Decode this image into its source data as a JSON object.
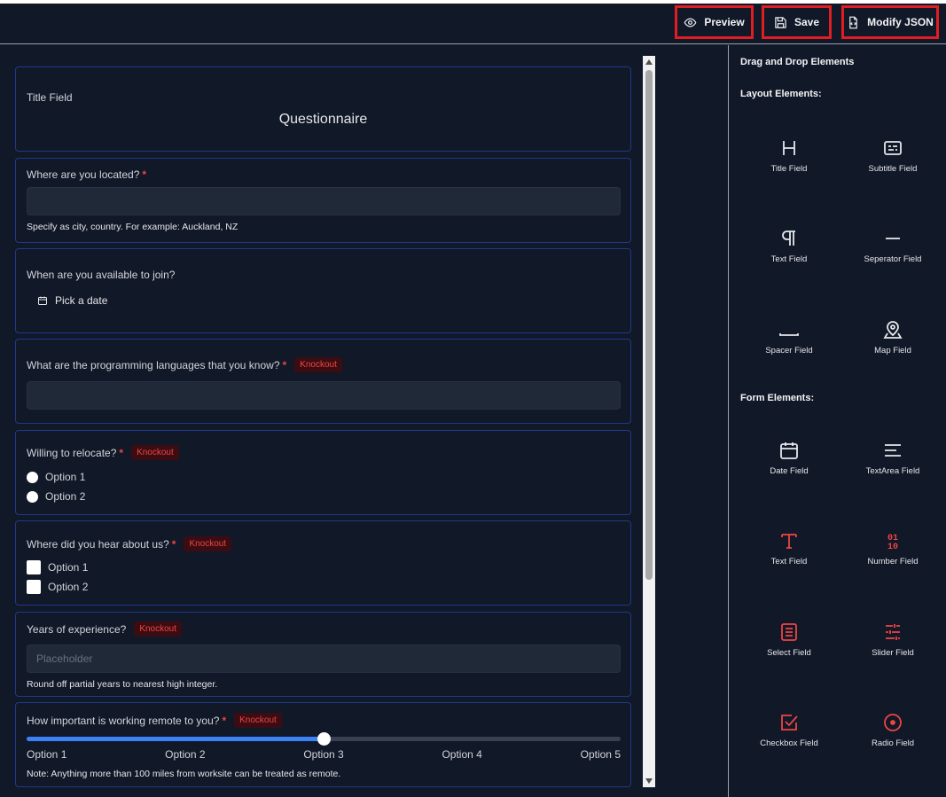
{
  "toolbar": {
    "preview_label": "Preview",
    "save_label": "Save",
    "json_label": "Modify JSON",
    "highlight_color": "#e11d24"
  },
  "form": {
    "title_card": {
      "label": "Title Field",
      "title": "Questionnaire"
    },
    "location": {
      "label": "Where are you located?",
      "required": "*",
      "help": "Specify as city, country. For example: Auckland, NZ"
    },
    "availability": {
      "label": "When are you available to join?",
      "date_button": "Pick a date"
    },
    "languages": {
      "label": "What are the programming languages that you know?",
      "required": "*",
      "badge": "Knockout"
    },
    "relocate": {
      "label": "Willing to relocate?",
      "required": "*",
      "badge": "Knockout",
      "options": [
        "Option 1",
        "Option 2"
      ]
    },
    "source": {
      "label": "Where did you hear about us?",
      "required": "*",
      "badge": "Knockout",
      "options": [
        "Option 1",
        "Option 2"
      ]
    },
    "experience": {
      "label": "Years of experience?",
      "badge": "Knockout",
      "placeholder": "Placeholder",
      "help": "Round off partial years to nearest high integer."
    },
    "remote": {
      "label": "How important is working remote to you?",
      "required": "*",
      "badge": "Knockout",
      "slider_value": 3,
      "slider_max": 5,
      "options": [
        "Option 1",
        "Option 2",
        "Option 3",
        "Option 4",
        "Option 5"
      ],
      "note": "Note: Anything more than 100 miles from worksite can be treated as remote."
    }
  },
  "sidebar": {
    "header": "Drag and Drop Elements",
    "layout_title": "Layout Elements:",
    "form_title": "Form Elements:",
    "layout_items": [
      {
        "label": "Title Field",
        "icon": "heading-icon"
      },
      {
        "label": "Subtitle Field",
        "icon": "subtitle-icon"
      },
      {
        "label": "Text Field",
        "icon": "pilcrow-icon"
      },
      {
        "label": "Seperator Field",
        "icon": "minus-icon"
      },
      {
        "label": "Spacer Field",
        "icon": "spacer-icon"
      },
      {
        "label": "Map Field",
        "icon": "map-pin-icon"
      }
    ],
    "form_items": [
      {
        "label": "Date Field",
        "icon": "calendar-icon"
      },
      {
        "label": "TextArea Field",
        "icon": "text-align-icon"
      },
      {
        "label": "Text Field",
        "icon": "type-icon"
      },
      {
        "label": "Number Field",
        "icon": "binary-icon"
      },
      {
        "label": "Select Field",
        "icon": "list-icon"
      },
      {
        "label": "Slider Field",
        "icon": "sliders-icon"
      },
      {
        "label": "Checkbox Field",
        "icon": "check-square-icon"
      },
      {
        "label": "Radio Field",
        "icon": "radio-icon"
      }
    ],
    "accent_color": "#ef4444",
    "icon_color": "#e5e7eb"
  }
}
